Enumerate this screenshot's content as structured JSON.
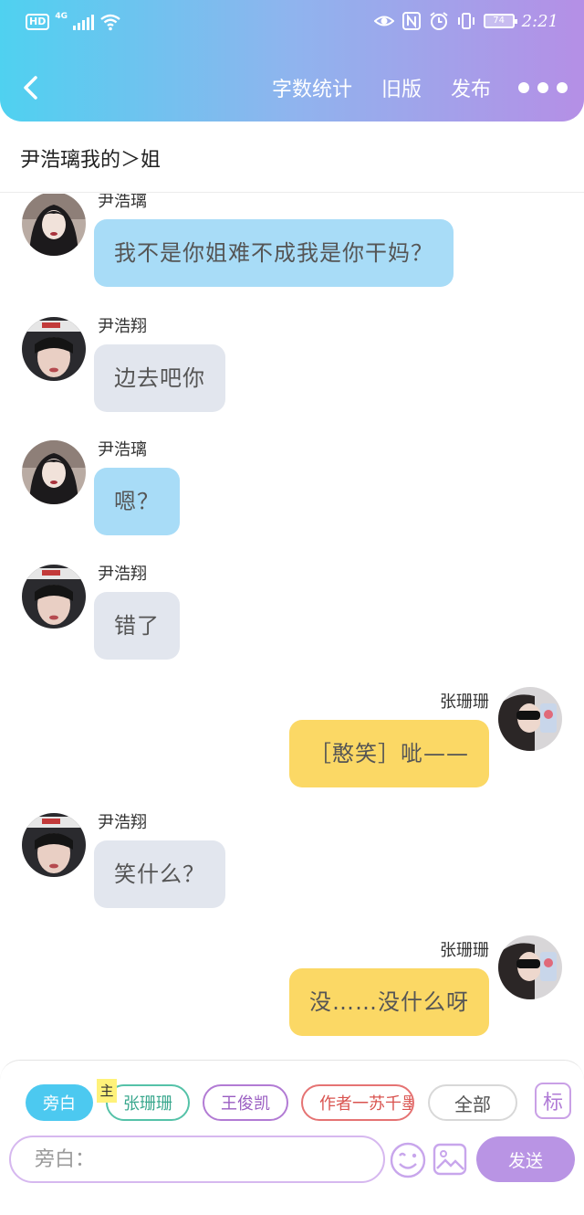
{
  "status_bar": {
    "hd": "HD",
    "network": "4G",
    "battery": "74",
    "time": "2:21"
  },
  "nav": {
    "word_count": "字数统计",
    "old_version": "旧版",
    "publish": "发布"
  },
  "title": "尹浩璃我的＞姐",
  "messages": [
    {
      "side": "left",
      "speaker": "尹浩璃",
      "text": "我不是你姐难不成我是你干妈？",
      "bubble": "blue"
    },
    {
      "side": "left",
      "speaker": "尹浩翔",
      "text": "边去吧你",
      "bubble": "gray"
    },
    {
      "side": "left",
      "speaker": "尹浩璃",
      "text": "嗯？",
      "bubble": "blue"
    },
    {
      "side": "left",
      "speaker": "尹浩翔",
      "text": "错了",
      "bubble": "gray"
    },
    {
      "side": "right",
      "speaker": "张珊珊",
      "text": "［憨笑］呲——",
      "bubble": "yellow"
    },
    {
      "side": "left",
      "speaker": "尹浩翔",
      "text": "笑什么？",
      "bubble": "gray"
    },
    {
      "side": "right",
      "speaker": "张珊珊",
      "text": "没……没什么呀",
      "bubble": "yellow"
    }
  ],
  "roles": {
    "aside": "旁白",
    "main_tag": "主",
    "role_a": "张珊珊",
    "role_b": "王俊凯",
    "role_c": "作者一苏千墨",
    "all": "全部",
    "mark": "标"
  },
  "input": {
    "placeholder": "旁白：",
    "value": "",
    "send": "发送"
  },
  "colors": {
    "header_start": "#4fd1f0",
    "header_end": "#b58fe6",
    "bubble_blue": "#a8dcf7",
    "bubble_gray": "#e2e6ee",
    "bubble_yellow": "#fbd865",
    "send_button": "#b994e4"
  },
  "icons": [
    "back-arrow-icon",
    "more-dots-icon",
    "eye-icon",
    "nfc-icon",
    "alarm-icon",
    "vibrate-icon",
    "wifi-icon",
    "emoji-icon",
    "image-icon"
  ]
}
